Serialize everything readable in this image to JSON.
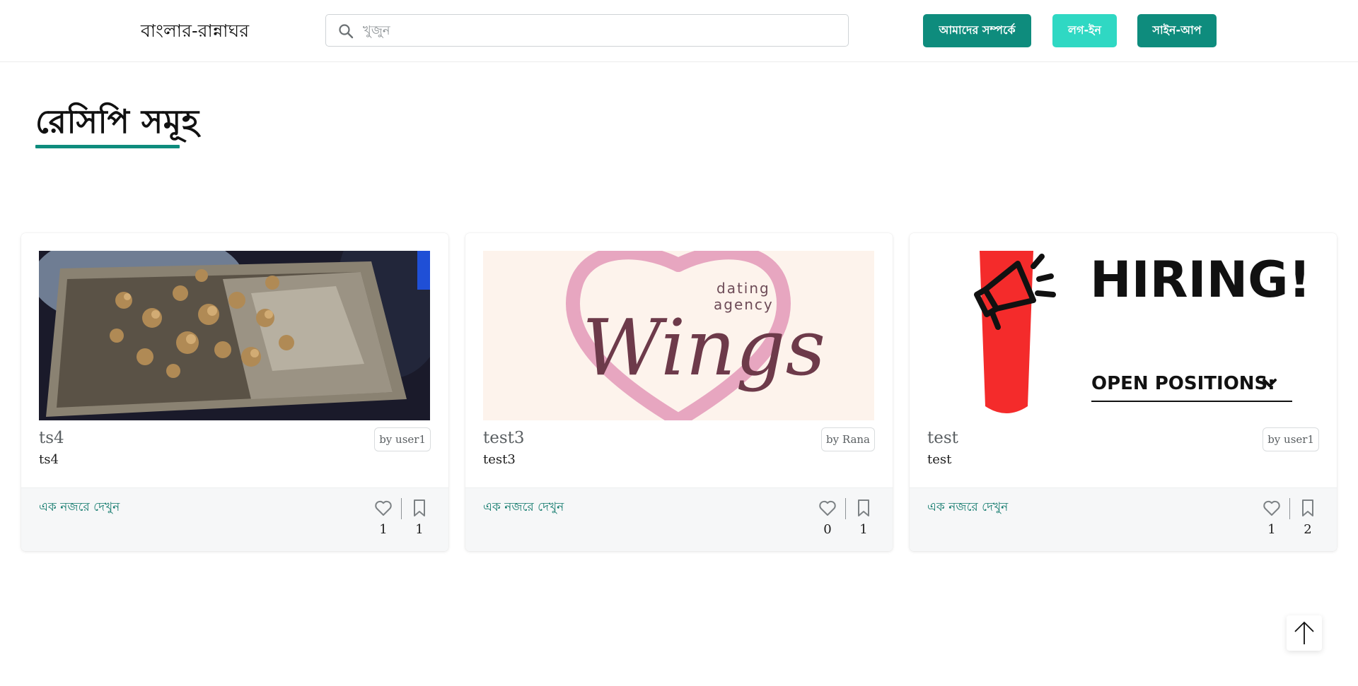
{
  "header": {
    "brand": "বাংলার-রান্নাঘর",
    "search_placeholder": "খুজুন",
    "nav": {
      "about": "আমাদের সম্পর্কে",
      "login": "লগ-ইন",
      "signup": "সাইন-আপ"
    }
  },
  "page": {
    "title": "রেসিপি সমূহ"
  },
  "recipes": [
    {
      "title": "ts4",
      "description": "ts4",
      "author": "by user1",
      "quick_view": "এক নজরে দেখুন",
      "likes": "1",
      "saves": "1",
      "image": "fried-food-photo"
    },
    {
      "title": "test3",
      "description": "test3",
      "author": "by Rana",
      "quick_view": "এক নজরে দেখুন",
      "likes": "0",
      "saves": "1",
      "image": "wings-dating-agency-logo"
    },
    {
      "title": "test",
      "description": "test",
      "author": "by user1",
      "quick_view": "এক নজরে দেখুন",
      "likes": "1",
      "saves": "2",
      "image": "hiring-poster"
    }
  ],
  "posters": {
    "wings_tag_line1": "dating",
    "wings_tag_line2": "agency",
    "wings_script": "Wings",
    "hiring_title": "HIRING!",
    "hiring_subtitle": "OPEN POSITIONS:"
  },
  "colors": {
    "accent": "#0e8c7d",
    "accent_light": "#2fd8c3",
    "link": "#127a6d"
  },
  "icons": {
    "search": "search-icon",
    "like": "heart-icon",
    "save": "bookmark-icon",
    "back_to_top": "arrow-up-icon"
  }
}
